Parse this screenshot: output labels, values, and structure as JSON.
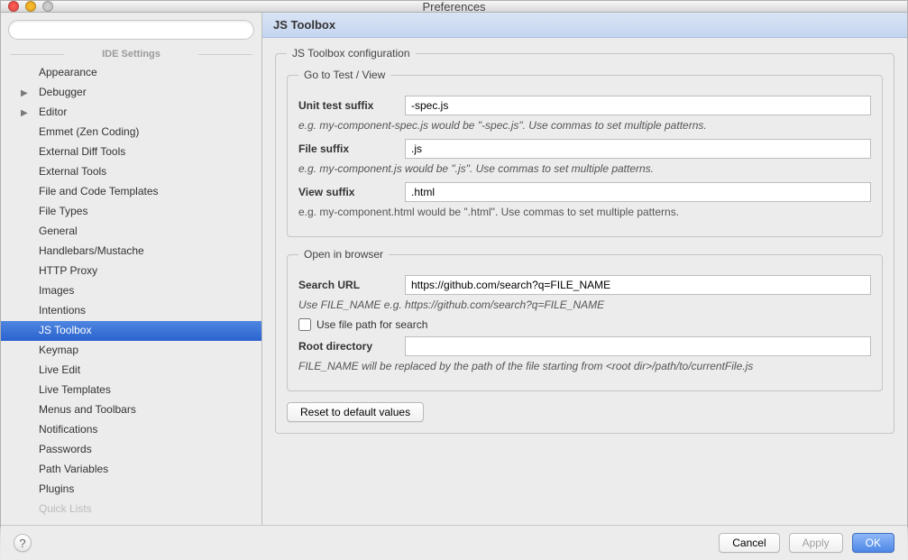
{
  "window": {
    "title": "Preferences"
  },
  "search": {
    "placeholder": ""
  },
  "sidebar": {
    "heading": "IDE Settings",
    "items": [
      {
        "label": "Appearance",
        "arrow": false
      },
      {
        "label": "Debugger",
        "arrow": true
      },
      {
        "label": "Editor",
        "arrow": true
      },
      {
        "label": "Emmet (Zen Coding)",
        "arrow": false
      },
      {
        "label": "External Diff Tools",
        "arrow": false
      },
      {
        "label": "External Tools",
        "arrow": false
      },
      {
        "label": "File and Code Templates",
        "arrow": false
      },
      {
        "label": "File Types",
        "arrow": false
      },
      {
        "label": "General",
        "arrow": false
      },
      {
        "label": "Handlebars/Mustache",
        "arrow": false
      },
      {
        "label": "HTTP Proxy",
        "arrow": false
      },
      {
        "label": "Images",
        "arrow": false
      },
      {
        "label": "Intentions",
        "arrow": false
      },
      {
        "label": "JS Toolbox",
        "arrow": false,
        "selected": true
      },
      {
        "label": "Keymap",
        "arrow": false
      },
      {
        "label": "Live Edit",
        "arrow": false
      },
      {
        "label": "Live Templates",
        "arrow": false
      },
      {
        "label": "Menus and Toolbars",
        "arrow": false
      },
      {
        "label": "Notifications",
        "arrow": false
      },
      {
        "label": "Passwords",
        "arrow": false
      },
      {
        "label": "Path Variables",
        "arrow": false
      },
      {
        "label": "Plugins",
        "arrow": false
      },
      {
        "label": "Quick Lists",
        "arrow": false,
        "faded": true
      }
    ]
  },
  "content": {
    "title": "JS Toolbox",
    "config_legend": "JS Toolbox configuration",
    "goto_legend": "Go to Test / View",
    "unit_suffix_label": "Unit test suffix",
    "unit_suffix_value": "-spec.js",
    "unit_suffix_hint": "e.g. my-component-spec.js would be \"-spec.js\". Use commas to set multiple patterns.",
    "file_suffix_label": "File suffix",
    "file_suffix_value": ".js",
    "file_suffix_hint": "e.g. my-component.js would be \".js\". Use commas to set multiple patterns.",
    "view_suffix_label": "View suffix",
    "view_suffix_value": ".html",
    "view_suffix_hint": "e.g. my-component.html would be \".html\". Use commas to set multiple patterns.",
    "browser_legend": "Open in browser",
    "search_url_label": "Search URL",
    "search_url_value": "https://github.com/search?q=FILE_NAME",
    "search_url_hint": "Use FILE_NAME e.g. https://github.com/search?q=FILE_NAME",
    "use_file_path_label": "Use file path for search",
    "root_dir_label": "Root directory",
    "root_dir_value": "",
    "root_dir_hint": "FILE_NAME will be replaced by the path of the file starting from <root dir>/path/to/currentFile.js",
    "reset_button": "Reset to default values"
  },
  "footer": {
    "cancel": "Cancel",
    "apply": "Apply",
    "ok": "OK"
  }
}
